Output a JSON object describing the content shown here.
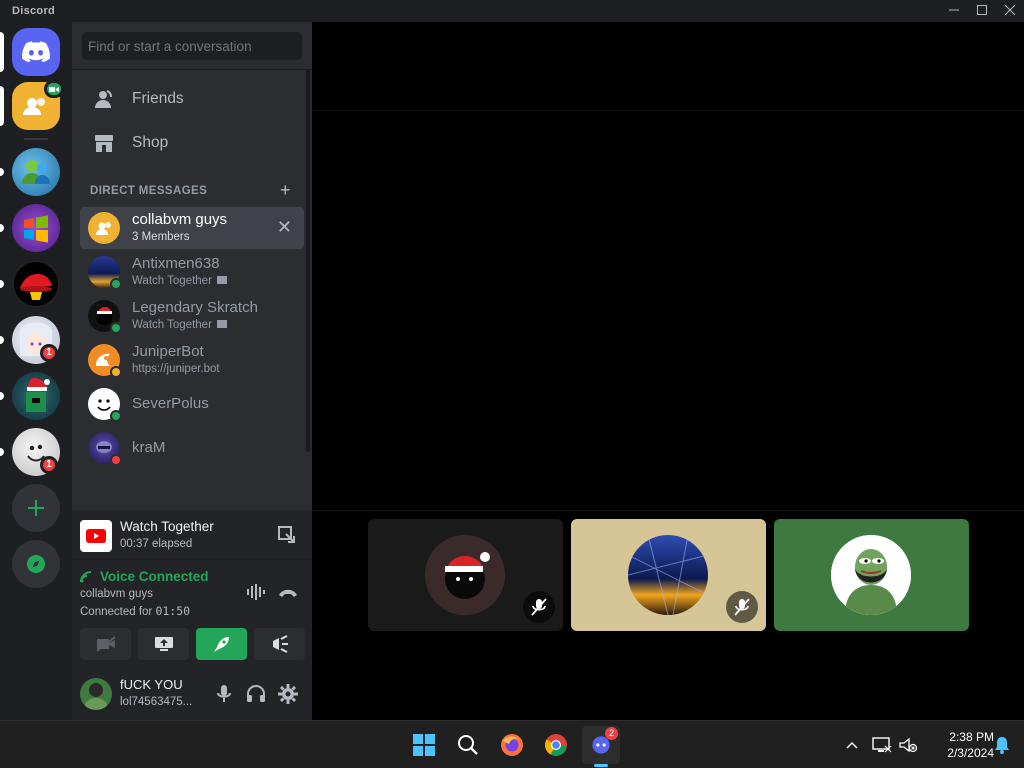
{
  "titlebar": {
    "app_name": "Discord"
  },
  "rail": {
    "servers": [
      {
        "name": "home",
        "badge": ""
      },
      {
        "name": "group-dm-collabvm",
        "badge": ""
      },
      {
        "name": "server-msn",
        "badge": ""
      },
      {
        "name": "server-windows",
        "badge": ""
      },
      {
        "name": "server-redhat",
        "badge": ""
      },
      {
        "name": "server-anime",
        "badge": "1"
      },
      {
        "name": "server-christmas",
        "badge": ""
      },
      {
        "name": "server-smiley",
        "badge": "1"
      }
    ]
  },
  "sidebar": {
    "search_placeholder": "Find or start a conversation",
    "nav": {
      "friends": "Friends",
      "shop": "Shop"
    },
    "dm_header": "DIRECT MESSAGES",
    "dm_add": "+",
    "dms": [
      {
        "name": "collabvm guys",
        "sub": "3 Members",
        "status": "",
        "active": true
      },
      {
        "name": "Antixmen638",
        "sub": "Watch Together",
        "status": "online"
      },
      {
        "name": "Legendary Skratch",
        "sub": "Watch Together",
        "status": "online"
      },
      {
        "name": "JuniperBot",
        "sub": "https://juniper.bot",
        "status": "idle"
      },
      {
        "name": "SeverPolus",
        "sub": "",
        "status": "online"
      },
      {
        "name": "kraM",
        "sub": "",
        "status": "dnd"
      }
    ]
  },
  "activity": {
    "title": "Watch Together",
    "elapsed": "00:37 elapsed"
  },
  "voice": {
    "status": "Voice Connected",
    "channel": "collabvm guys",
    "connected_label": "Connected for ",
    "connected_time": "01:50",
    "status_color": "#23a55a"
  },
  "user": {
    "name": "fUCK YOU",
    "tag": "lol74563475..."
  },
  "call": {
    "tiles": [
      {
        "name": "tile-user-santa",
        "bg": "#1a1a1a",
        "muted": true
      },
      {
        "name": "tile-user-antixmen",
        "bg": "#d6c597",
        "muted": true
      },
      {
        "name": "tile-user-pepe",
        "bg": "#3e7a3f",
        "muted": false
      }
    ]
  },
  "taskbar": {
    "time": "2:38 PM",
    "date": "2/3/2024",
    "discord_badge": "2"
  }
}
